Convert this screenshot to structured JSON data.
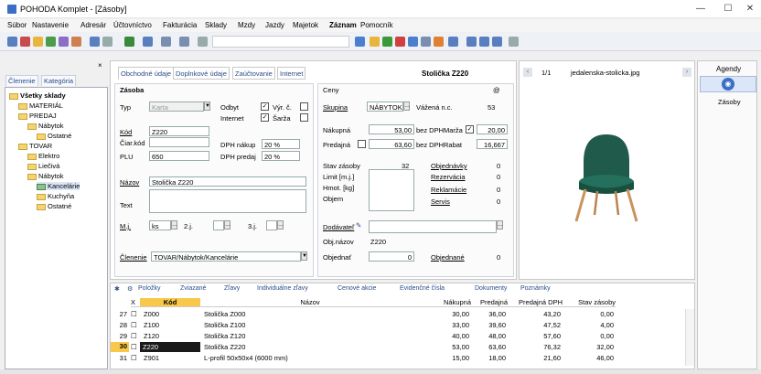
{
  "window": {
    "title": "POHODA Komplet - [Zásoby]",
    "min": "—",
    "max": "☐",
    "close": "✕"
  },
  "menu": [
    "Súbor",
    "Nastavenie",
    "Adresár",
    "Účtovníctvo",
    "Fakturácia",
    "Sklady",
    "Mzdy",
    "Jazdy",
    "Majetok",
    "Záznam",
    "Pomocník"
  ],
  "leftpanel": {
    "close": "×",
    "tabs": [
      "Členenie",
      "Kategória"
    ],
    "tree": {
      "root": "Všetky sklady",
      "items": [
        "MATERIÁL",
        "PREDAJ",
        "Nábytok",
        "Ostatné",
        "TOVAR",
        "Elektro",
        "Liečivá",
        "Nábytok",
        "Kancelárie",
        "Kuchyňa",
        "Ostatné"
      ]
    }
  },
  "form": {
    "tabs": [
      "Obchodné údaje",
      "Doplnkové údaje",
      "Zaúčtovanie",
      "Internet"
    ],
    "header_title": "Stolička Z220",
    "zasoba": {
      "section": "Zásoba",
      "typ_label": "Typ",
      "typ_value": "Karta",
      "odbyt_label": "Odbyt",
      "vyr_label": "Výr. č.",
      "internet_label": "Internet",
      "sarza_label": "Šarža",
      "kod_label": "Kód",
      "kod_value": "Z220",
      "ciarkod_label": "Čiar.kód",
      "plu_label": "PLU",
      "plu_value": "650",
      "dph_nakup_label": "DPH nákup",
      "dph_nakup_value": "20 %",
      "dph_predaj_label": "DPH predaj",
      "dph_predaj_value": "20 %",
      "nazov_label": "Názov",
      "nazov_value": "Stolička Z220",
      "text_label": "Text",
      "mj_label": "M.j.",
      "mj_value": "ks",
      "mj2_label": "2.j.",
      "mj3_label": "3.j.",
      "clenenie_label": "Členenie",
      "clenenie_value": "TOVAR/Nábytok/Kancelárie"
    },
    "ceny": {
      "section": "Ceny",
      "at": "@",
      "skupina_label": "Skupina",
      "skupina_value": "NÁBYTOK",
      "vazena_label": "Vážená n.c.",
      "vazena_value": "53",
      "nakupna_label": "Nákupná",
      "nakupna_value": "53,00",
      "bez_dph1": "bez DPH",
      "marza_label": "Marža",
      "marza_value": "20,00",
      "predajna_label": "Predajná",
      "predajna_value": "63,60",
      "bez_dph2": "bez DPH",
      "rabat_label": "Rabat",
      "rabat_value": "16,667",
      "stav_label": "Stav zásoby",
      "stav_value": "32",
      "limit_label": "Limit [m.j.]",
      "hmot_label": "Hmot. [kg]",
      "objem_label": "Objem",
      "objednavky_label": "Objednávky",
      "objednavky_value": "0",
      "rezervacia_label": "Rezervácia",
      "rezervacia_value": "0",
      "reklamacie_label": "Reklamácie",
      "reklamacie_value": "0",
      "servis_label": "Servis",
      "servis_value": "0",
      "dodavatel_label": "Dodávateľ",
      "objnazov_label": "Obj.názov",
      "objnazov_value": "Z220",
      "objednat_label": "Objednať",
      "objednat_value": "0",
      "objednane_label": "Objednané",
      "objednane_value": "0"
    }
  },
  "picture": {
    "counter": "1/1",
    "filename": "jedalenska-stolicka.jpg"
  },
  "agendy": {
    "title": "Agendy",
    "item": "Zásoby"
  },
  "grid": {
    "tabs": [
      "Položky",
      "Zviazané",
      "Zľavy",
      "Individuálne zľavy",
      "Cenové akcie",
      "Evidenčné čísla",
      "Dokumenty",
      "Poznámky"
    ],
    "headers": [
      "X",
      "Kód",
      "Názov",
      "Nákupná",
      "Predajná",
      "Predajná DPH",
      "Stav zásoby"
    ],
    "rows": [
      {
        "n": "27",
        "kod": "Z000",
        "nazov": "Stolička Z000",
        "nak": "30,00",
        "pred": "36,00",
        "dph": "43,20",
        "stav": "0,00"
      },
      {
        "n": "28",
        "kod": "Z100",
        "nazov": "Stolička Z100",
        "nak": "33,00",
        "pred": "39,60",
        "dph": "47,52",
        "stav": "4,00"
      },
      {
        "n": "29",
        "kod": "Z120",
        "nazov": "Stolička Z120",
        "nak": "40,00",
        "pred": "48,00",
        "dph": "57,60",
        "stav": "0,00"
      },
      {
        "n": "30",
        "kod": "Z220",
        "nazov": "Stolička Z220",
        "nak": "53,00",
        "pred": "63,60",
        "dph": "76,32",
        "stav": "32,00"
      },
      {
        "n": "31",
        "kod": "Z901",
        "nazov": "L-profil 50x50x4 (6000 mm)",
        "nak": "15,00",
        "pred": "18,00",
        "dph": "21,60",
        "stav": "46,00"
      }
    ]
  },
  "colors": {
    "accent": "#2a4c8a",
    "selected_row": "#1a1a1a",
    "selected_num": "#f7c84a"
  }
}
